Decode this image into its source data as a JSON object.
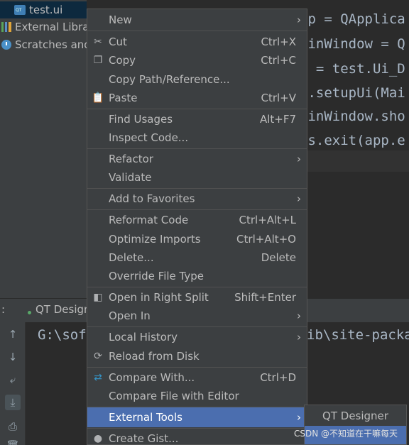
{
  "project_tree": {
    "items": [
      {
        "label": "test.ui",
        "icon": "qt-ui-file-icon",
        "selected": true
      },
      {
        "label": "External Librar",
        "icon": "library-icon"
      },
      {
        "label": "Scratches and",
        "icon": "scratch-icon"
      }
    ]
  },
  "editor": {
    "lines": [
      "op = QApplica",
      "ainWindow = Q",
      "i = test.Ui_D",
      "i.setupUi(Mai",
      "ainWindow.sho",
      "ys.exit(app.e"
    ]
  },
  "run_panel": {
    "prefix": ":",
    "tab_label": "QT Design",
    "console_left": "G:\\sof",
    "console_right": "ib\\site-packa",
    "buttons": [
      {
        "name": "up-arrow-icon",
        "glyph": "↑"
      },
      {
        "name": "down-arrow-icon",
        "glyph": "↓"
      },
      {
        "name": "soft-wrap-icon",
        "glyph": "⤶"
      },
      {
        "name": "scroll-to-end-icon",
        "glyph": "⤓"
      },
      {
        "name": "print-icon",
        "glyph": "⎙"
      },
      {
        "name": "trash-icon",
        "glyph": "🗑"
      }
    ]
  },
  "context_menu": {
    "items": [
      {
        "label": "New",
        "shortcut": "",
        "submenu": true
      },
      {
        "label": "Cut",
        "shortcut": "Ctrl+X",
        "icon": "cut-icon"
      },
      {
        "label": "Copy",
        "shortcut": "Ctrl+C",
        "icon": "copy-icon"
      },
      {
        "label": "Copy Path/Reference...",
        "shortcut": ""
      },
      {
        "label": "Paste",
        "shortcut": "Ctrl+V",
        "icon": "paste-icon"
      },
      {
        "label": "Find Usages",
        "shortcut": "Alt+F7"
      },
      {
        "label": "Inspect Code...",
        "shortcut": ""
      },
      {
        "label": "Refactor",
        "shortcut": "",
        "submenu": true
      },
      {
        "label": "Validate",
        "shortcut": ""
      },
      {
        "label": "Add to Favorites",
        "shortcut": "",
        "submenu": true
      },
      {
        "label": "Reformat Code",
        "shortcut": "Ctrl+Alt+L"
      },
      {
        "label": "Optimize Imports",
        "shortcut": "Ctrl+Alt+O"
      },
      {
        "label": "Delete...",
        "shortcut": "Delete"
      },
      {
        "label": "Override File Type",
        "shortcut": ""
      },
      {
        "label": "Open in Right Split",
        "shortcut": "Shift+Enter",
        "icon": "split-icon"
      },
      {
        "label": "Open In",
        "shortcut": "",
        "submenu": true
      },
      {
        "label": "Local History",
        "shortcut": "",
        "submenu": true
      },
      {
        "label": "Reload from Disk",
        "shortcut": "",
        "icon": "reload-icon"
      },
      {
        "label": "Compare With...",
        "shortcut": "Ctrl+D",
        "icon": "compare-icon"
      },
      {
        "label": "Compare File with Editor",
        "shortcut": ""
      },
      {
        "label": "External Tools",
        "shortcut": "",
        "submenu": true,
        "highlighted": true
      },
      {
        "label": "Create Gist...",
        "shortcut": "",
        "icon": "github-icon"
      }
    ]
  },
  "submenu": {
    "items": [
      "QT Designer",
      ""
    ]
  },
  "watermark": "CSDN @不知道在干嘛每天",
  "colors": {
    "menu_bg": "#3c3f41",
    "highlight": "#4b6eaf",
    "editor_bg": "#2b2b2b",
    "text": "#bbbbbb"
  }
}
